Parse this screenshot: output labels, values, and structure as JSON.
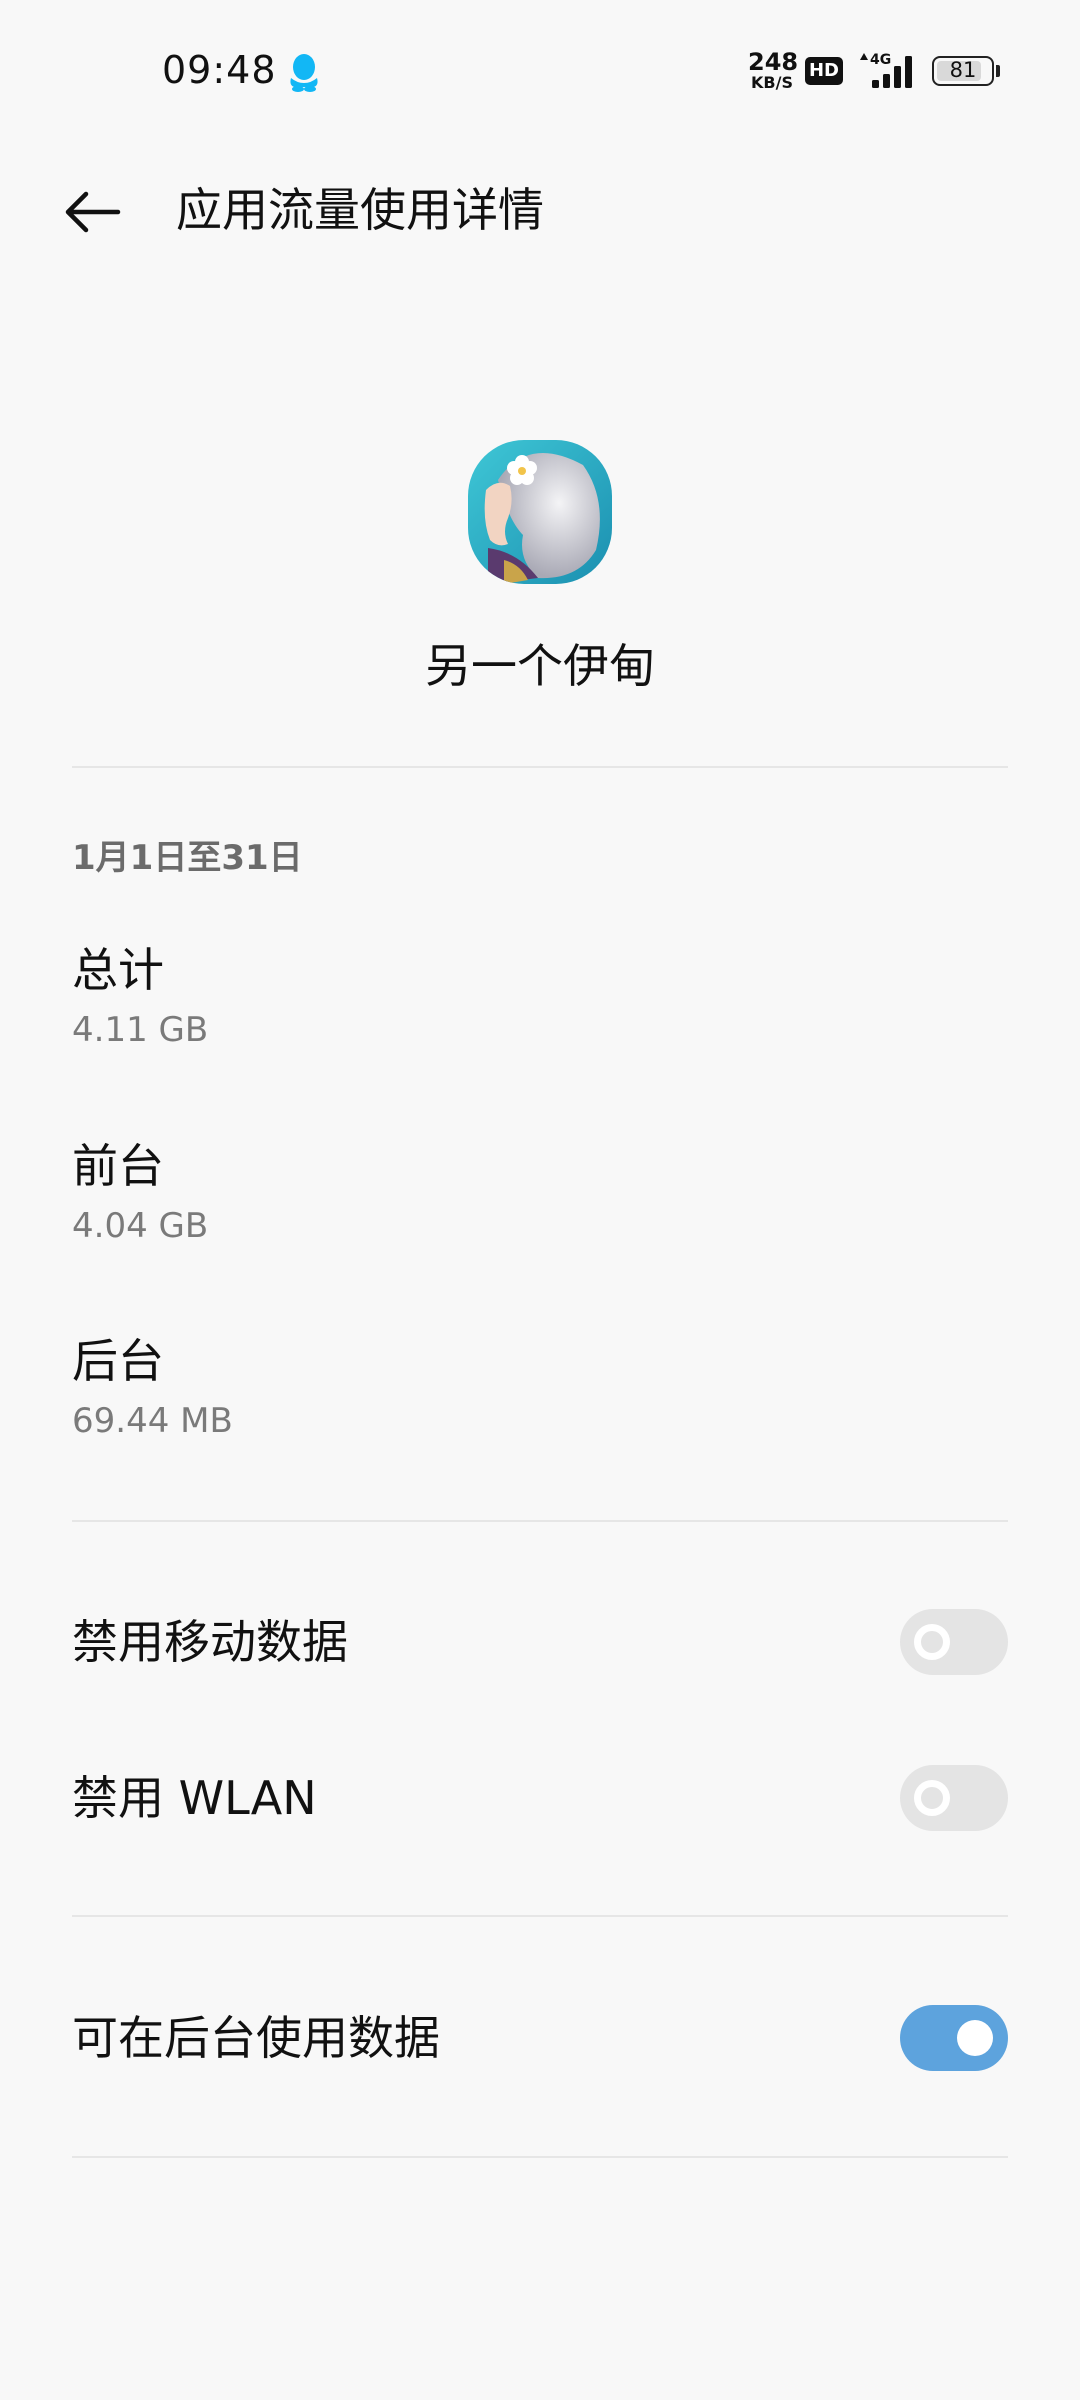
{
  "status_bar": {
    "time": "09:48",
    "net_speed_value": "248",
    "net_speed_unit": "KB/S",
    "hd_badge": "HD",
    "network_type": "4G",
    "battery_level": "81"
  },
  "header": {
    "title": "应用流量使用详情",
    "back_icon": "arrow-left-icon"
  },
  "app": {
    "name": "另一个伊甸",
    "icon": "app-icon-anime-character"
  },
  "usage": {
    "period": "1月1日至31日",
    "items": [
      {
        "label": "总计",
        "value": "4.11 GB"
      },
      {
        "label": "前台",
        "value": "4.04 GB"
      },
      {
        "label": "后台",
        "value": "69.44 MB"
      }
    ]
  },
  "settings": [
    {
      "label": "禁用移动数据",
      "enabled": false
    },
    {
      "label": "禁用 WLAN",
      "enabled": false
    },
    {
      "label": "可在后台使用数据",
      "enabled": true
    }
  ],
  "colors": {
    "background": "#f8f8f8",
    "toggle_on": "#5da3dd",
    "toggle_off": "#e4e4e4",
    "qq_icon": "#12b7f5"
  }
}
